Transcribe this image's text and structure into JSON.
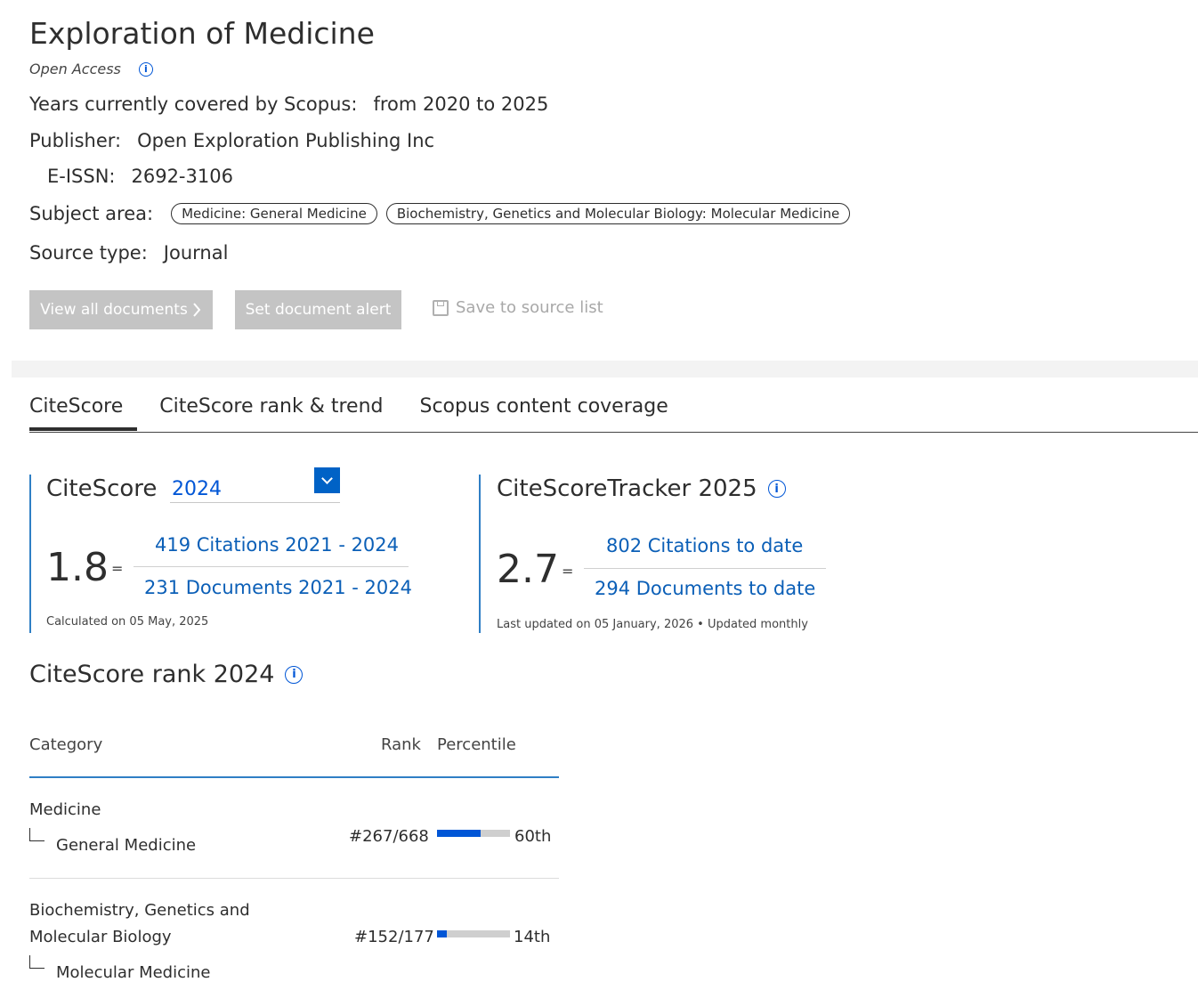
{
  "source": {
    "title": "Exploration of Medicine",
    "open_access": "Open Access",
    "years_label": "Years currently covered by Scopus:",
    "years_value": "from 2020 to 2025",
    "publisher_label": "Publisher:",
    "publisher_value": "Open Exploration Publishing Inc",
    "eissn_label": "E-ISSN:",
    "eissn_value": "2692-3106",
    "subject_label": "Subject area:",
    "subjects": [
      "Medicine: General Medicine",
      "Biochemistry, Genetics and Molecular Biology: Molecular Medicine"
    ],
    "source_type_label": "Source type:",
    "source_type_value": "Journal"
  },
  "actions": {
    "view_all": "View all documents",
    "set_alert": "Set document alert",
    "save": "Save to source list"
  },
  "tabs": [
    "CiteScore",
    "CiteScore rank & trend",
    "Scopus content coverage"
  ],
  "citescore": {
    "title": "CiteScore",
    "year": "2024",
    "value": "1.8",
    "equals": "=",
    "citations": "419 Citations 2021 - 2024",
    "documents": "231 Documents 2021 - 2024",
    "calculated": "Calculated on 05 May, 2025"
  },
  "tracker": {
    "title": "CiteScoreTracker 2025",
    "value": "2.7",
    "equals": "=",
    "citations": "802 Citations to date",
    "documents": "294 Documents to date",
    "updated": "Last updated on 05 January, 2026 • Updated monthly"
  },
  "rank": {
    "title": "CiteScore rank 2024",
    "headers": {
      "category": "Category",
      "rank": "Rank",
      "percentile": "Percentile"
    },
    "rows": [
      {
        "parent_line1": "Medicine",
        "parent_line2": "",
        "sub": "General Medicine",
        "rank": "#267/668",
        "percentile": "60th",
        "percentile_value": 60
      },
      {
        "parent_line1": "Biochemistry, Genetics and",
        "parent_line2": "Molecular Biology",
        "sub": "Molecular Medicine",
        "rank": "#152/177",
        "percentile": "14th",
        "percentile_value": 14
      }
    ]
  },
  "colors": {
    "link": "#0b5fb7",
    "accent": "#0056d6",
    "button_disabled": "#c4c4c4",
    "divider_blue": "#2f7fc5"
  },
  "icons": {
    "info": "info-circle-icon",
    "dropdown": "chevron-down-icon",
    "save": "floppy-disk-icon",
    "button_arrow": "chevron-right-icon"
  }
}
